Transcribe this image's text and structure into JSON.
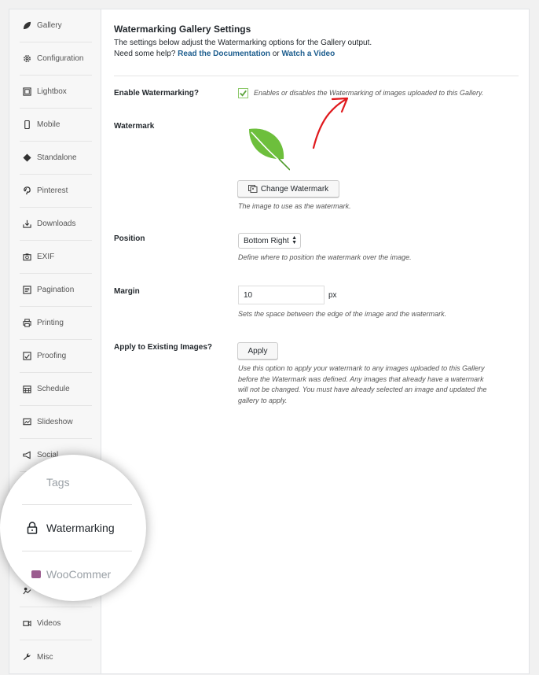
{
  "sidebar": {
    "items": [
      {
        "label": "Gallery",
        "icon": "leaf-icon"
      },
      {
        "label": "Configuration",
        "icon": "gear-icon"
      },
      {
        "label": "Lightbox",
        "icon": "lightbox-icon"
      },
      {
        "label": "Mobile",
        "icon": "mobile-icon"
      },
      {
        "label": "Standalone",
        "icon": "standalone-icon"
      },
      {
        "label": "Pinterest",
        "icon": "pinterest-icon"
      },
      {
        "label": "Downloads",
        "icon": "download-icon"
      },
      {
        "label": "EXIF",
        "icon": "camera-icon"
      },
      {
        "label": "Pagination",
        "icon": "pagination-icon"
      },
      {
        "label": "Printing",
        "icon": "printer-icon"
      },
      {
        "label": "Proofing",
        "icon": "proofing-icon"
      },
      {
        "label": "Schedule",
        "icon": "calendar-icon"
      },
      {
        "label": "Slideshow",
        "icon": "slideshow-icon"
      },
      {
        "label": "Social",
        "icon": "megaphone-icon"
      },
      {
        "label": "Videos",
        "icon": "video-icon"
      },
      {
        "label": "Misc",
        "icon": "wrench-icon"
      }
    ]
  },
  "magnifier": {
    "tags": "Tags",
    "watermarking": "Watermarking",
    "woocommerce": "WooCommer"
  },
  "main": {
    "title": "Watermarking Gallery Settings",
    "description": "The settings below adjust the Watermarking options for the Gallery output.",
    "help_prefix": "Need some help?",
    "doc_link": "Read the Documentation",
    "or": "or",
    "video_link": "Watch a Video",
    "enable": {
      "label": "Enable Watermarking?",
      "checked": true,
      "help": "Enables or disables the Watermarking of images uploaded to this Gallery."
    },
    "watermark": {
      "label": "Watermark",
      "button": "Change Watermark",
      "help": "The image to use as the watermark."
    },
    "position": {
      "label": "Position",
      "value": "Bottom Right",
      "help": "Define where to position the watermark over the image."
    },
    "margin": {
      "label": "Margin",
      "value": "10",
      "unit": "px",
      "help": "Sets the space between the edge of the image and the watermark."
    },
    "apply": {
      "label": "Apply to Existing Images?",
      "button": "Apply",
      "help_lines": [
        "Use this option to apply your watermark to any images uploaded to this Gallery",
        "before the Watermark was defined. Any images that already have a watermark",
        "will not be changed. You must have already selected an image and updated the",
        "gallery to apply."
      ]
    }
  },
  "colors": {
    "accent_link": "#1c5d8e",
    "leaf_green": "#6dbf3c",
    "check_green": "#5ba33a",
    "arrow_red": "#e0191d"
  }
}
